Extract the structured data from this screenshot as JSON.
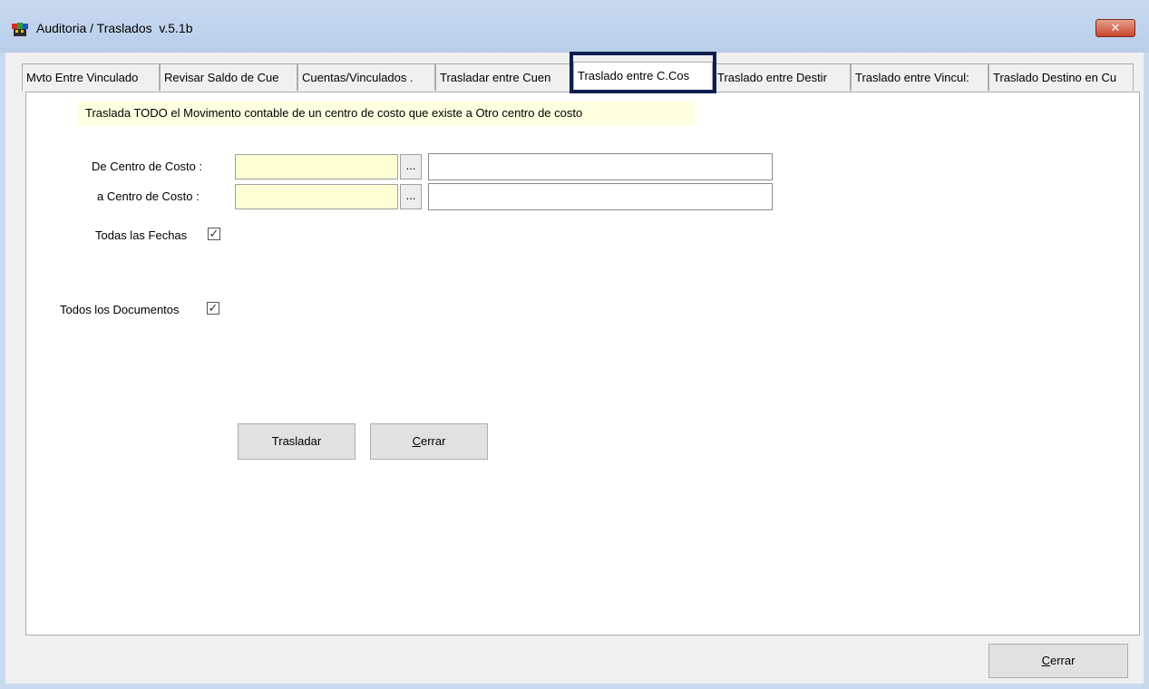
{
  "window": {
    "title": "Auditoria / Traslados  v.5.1b",
    "close_glyph": "✕",
    "app_icon": "app-icon"
  },
  "tabs": [
    {
      "label": "Mvto Entre Vinculado",
      "active": false
    },
    {
      "label": "Revisar Saldo de Cue",
      "active": false
    },
    {
      "label": "Cuentas/Vinculados .",
      "active": false
    },
    {
      "label": "Trasladar entre Cuen",
      "active": false
    },
    {
      "label": "Traslado entre C.Cos",
      "active": true
    },
    {
      "label": "Traslado entre Destir",
      "active": false
    },
    {
      "label": "Traslado entre Vincul:",
      "active": false
    },
    {
      "label": "Traslado Destino en Cu",
      "active": false
    }
  ],
  "panel": {
    "note": "Traslada TODO el Movimento contable de un centro de costo que existe a Otro centro de costo",
    "from_label": "De Centro de Costo :",
    "to_label": "a Centro de Costo :",
    "from_code": "",
    "from_desc": "",
    "to_code": "",
    "to_desc": "",
    "browse_label": "...",
    "all_dates_label": "Todas las Fechas",
    "all_dates_checked": true,
    "all_docs_label": "Todos los Documentos",
    "all_docs_checked": true,
    "check_glyph": "✓",
    "move_button": "Trasladar",
    "close_button_first": "C",
    "close_button_rest": "errar"
  },
  "footer": {
    "close_button_first": "C",
    "close_button_rest": "errar"
  },
  "colors": {
    "title_bar": "#b9cde9",
    "required_field": "#ffffd6",
    "note_bg": "#ffffe1",
    "focus_outline": "#0d1f4f",
    "close_red": "#c7452c"
  }
}
